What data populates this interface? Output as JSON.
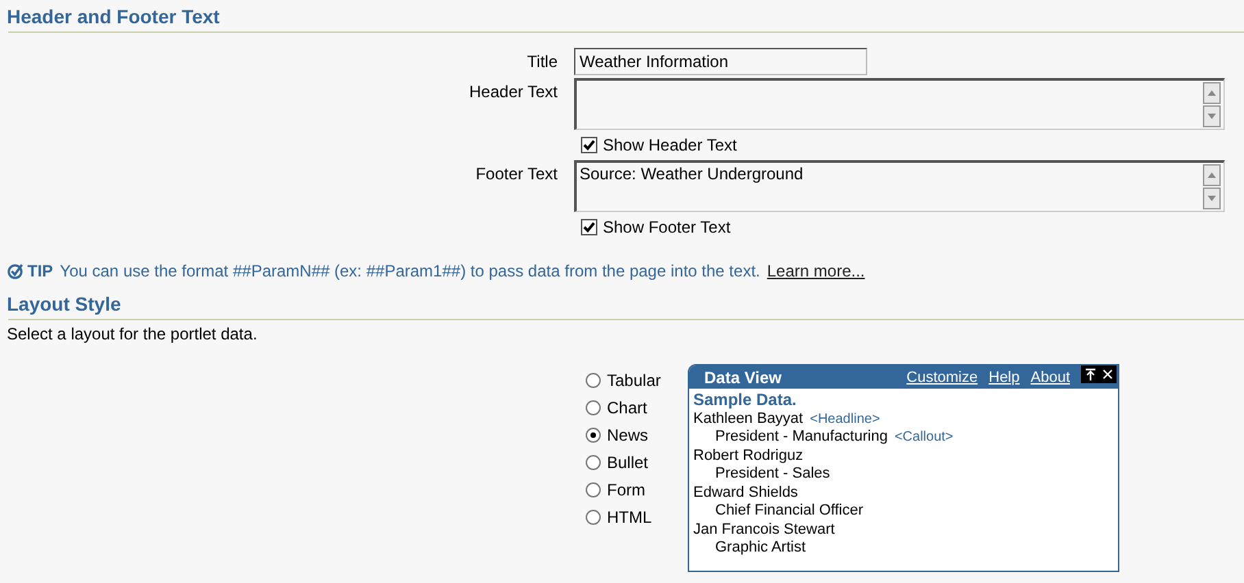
{
  "header_footer": {
    "title": "Header and Footer Text",
    "fields": [
      {
        "kind": "text",
        "label": "Title",
        "value": "Weather Information"
      },
      {
        "kind": "textarea",
        "label": "Header Text"
      },
      {
        "kind": "checkbox",
        "label": "Show Header Text",
        "checked": true
      },
      {
        "kind": "textarea",
        "label": "Footer Text",
        "value": "Source: Weather Underground"
      },
      {
        "kind": "checkbox",
        "label": "Show Footer Text",
        "checked": true
      }
    ],
    "tip": {
      "label": "TIP",
      "text": "You can use the format ##ParamN## (ex: ##Param1##) to pass data from the page into the text.",
      "link": "Learn more..."
    }
  },
  "layout_style": {
    "title": "Layout Style",
    "description": "Select a layout for the portlet data.",
    "options": [
      {
        "label": "Tabular",
        "selected": false
      },
      {
        "label": "Chart",
        "selected": false
      },
      {
        "label": "News",
        "selected": true
      },
      {
        "label": "Bullet",
        "selected": false
      },
      {
        "label": "Form",
        "selected": false
      },
      {
        "label": "HTML",
        "selected": false
      }
    ],
    "preview": {
      "title": "Data View",
      "links": [
        "Customize",
        "Help",
        "About"
      ],
      "heading": "Sample Data.",
      "people": [
        {
          "name": "Kathleen Bayyat",
          "name_tag": "<Headline>",
          "role": "President - Manufacturing",
          "role_tag": "<Callout>"
        },
        {
          "name": "Robert Rodriguz",
          "role": "President - Sales"
        },
        {
          "name": "Edward Shields",
          "role": "Chief Financial Officer"
        },
        {
          "name": "Jan Francois Stewart",
          "role": "Graphic Artist"
        }
      ]
    }
  }
}
